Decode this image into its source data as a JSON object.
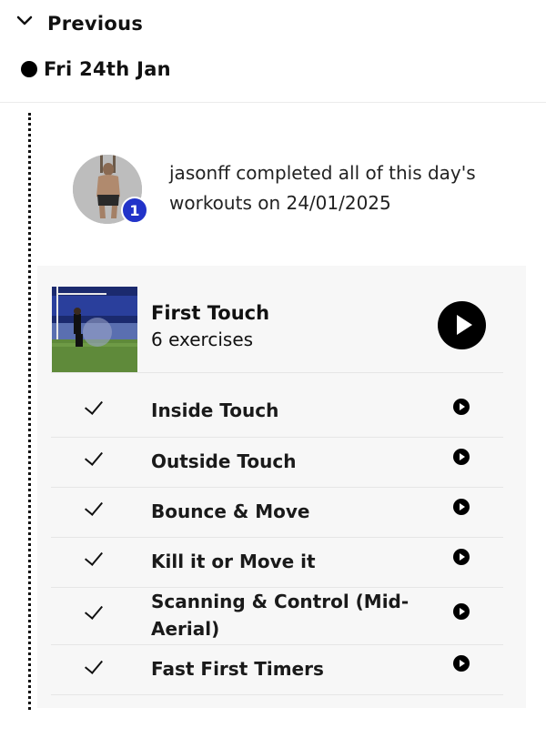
{
  "header": {
    "collapse_label": "Previous",
    "date_label": "Fri 24th Jan"
  },
  "activity": {
    "badge_count": "1",
    "completed_text": "jasonff completed all of this day's workouts on 24/01/2025"
  },
  "workout": {
    "title": "First Touch",
    "subtitle": "6 exercises",
    "exercises": [
      {
        "name": "Inside Touch",
        "done": true
      },
      {
        "name": "Outside Touch",
        "done": true
      },
      {
        "name": "Bounce & Move",
        "done": true
      },
      {
        "name": "Kill it or Move it",
        "done": true
      },
      {
        "name": "Scanning & Control (Mid-Aerial)",
        "done": true
      },
      {
        "name": "Fast First Timers",
        "done": true
      }
    ]
  },
  "colors": {
    "badge": "#2233c9",
    "card_bg": "#f7f7f7",
    "play": "#000000"
  }
}
